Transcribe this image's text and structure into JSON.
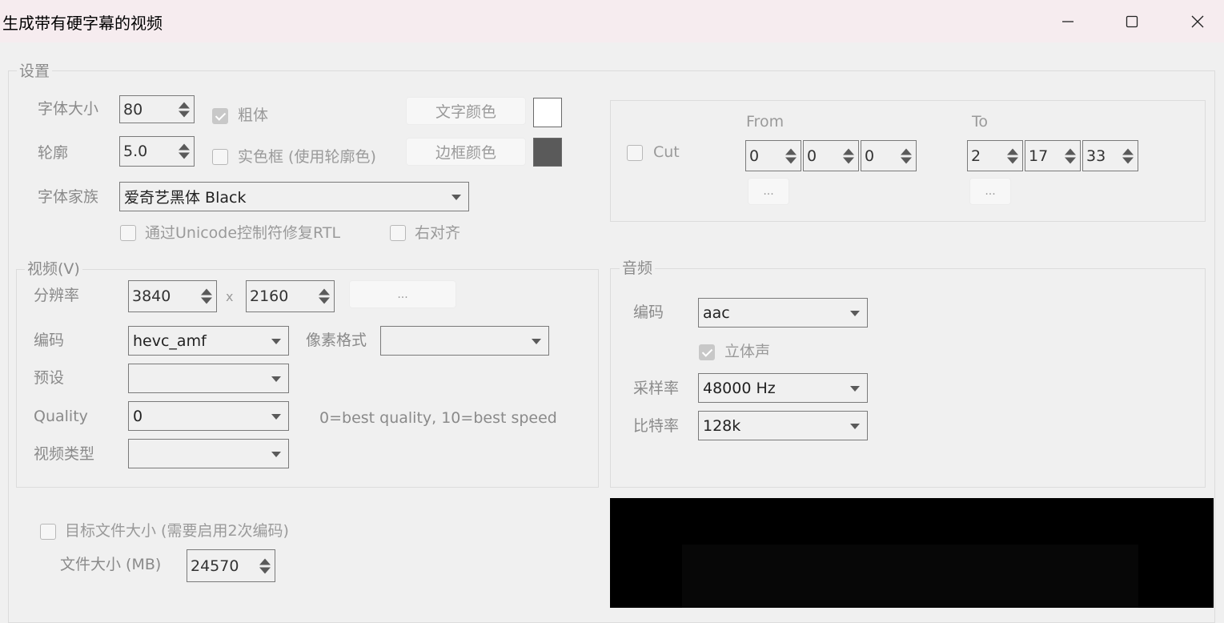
{
  "window": {
    "title": "生成带有硬字幕的视频"
  },
  "settings": {
    "legend": "设置",
    "font_size": {
      "label": "字体大小",
      "value": "80"
    },
    "bold": {
      "label": "粗体",
      "checked": true
    },
    "text_color": {
      "label": "文字颜色",
      "color": "#ffffff"
    },
    "outline": {
      "label": "轮廓",
      "value": "5.0"
    },
    "solid_box": {
      "label": "实色框 (使用轮廓色)",
      "checked": false
    },
    "border_color": {
      "label": "边框颜色",
      "color": "#5a5a5a"
    },
    "font_family": {
      "label": "字体家族",
      "value": "爱奇艺黑体 Black"
    },
    "fix_rtl": {
      "label": "通过Unicode控制符修复RTL",
      "checked": false
    },
    "right_align": {
      "label": "右对齐",
      "checked": false
    }
  },
  "cut": {
    "label": "Cut",
    "checked": false,
    "from": {
      "label": "From",
      "h": "0",
      "m": "0",
      "s": "0",
      "button": "..."
    },
    "to": {
      "label": "To",
      "h": "2",
      "m": "17",
      "s": "33",
      "button": "..."
    }
  },
  "video": {
    "legend": "视频(V)",
    "resolution": {
      "label": "分辨率",
      "width": "3840",
      "sep": "x",
      "height": "2160",
      "button": "..."
    },
    "encoding": {
      "label": "编码",
      "value": "hevc_amf"
    },
    "pixel_format": {
      "label": "像素格式",
      "value": ""
    },
    "preset": {
      "label": "预设",
      "value": ""
    },
    "quality": {
      "label": "Quality",
      "value": "0",
      "hint": "0=best quality, 10=best speed"
    },
    "video_type": {
      "label": "视频类型",
      "value": ""
    }
  },
  "audio": {
    "legend": "音频",
    "encoding": {
      "label": "编码",
      "value": "aac"
    },
    "stereo": {
      "label": "立体声",
      "checked": true
    },
    "sample_rate": {
      "label": "采样率",
      "value": "48000 Hz"
    },
    "bitrate": {
      "label": "比特率",
      "value": "128k"
    }
  },
  "target_size": {
    "label": "目标文件大小 (需要启用2次编码)",
    "checked": false,
    "file_size": {
      "label": "文件大小 (MB)",
      "value": "24570"
    }
  },
  "colors": {
    "title_bar": "#f6ecef",
    "background": "#f0f0f0",
    "preview": "#000000"
  }
}
